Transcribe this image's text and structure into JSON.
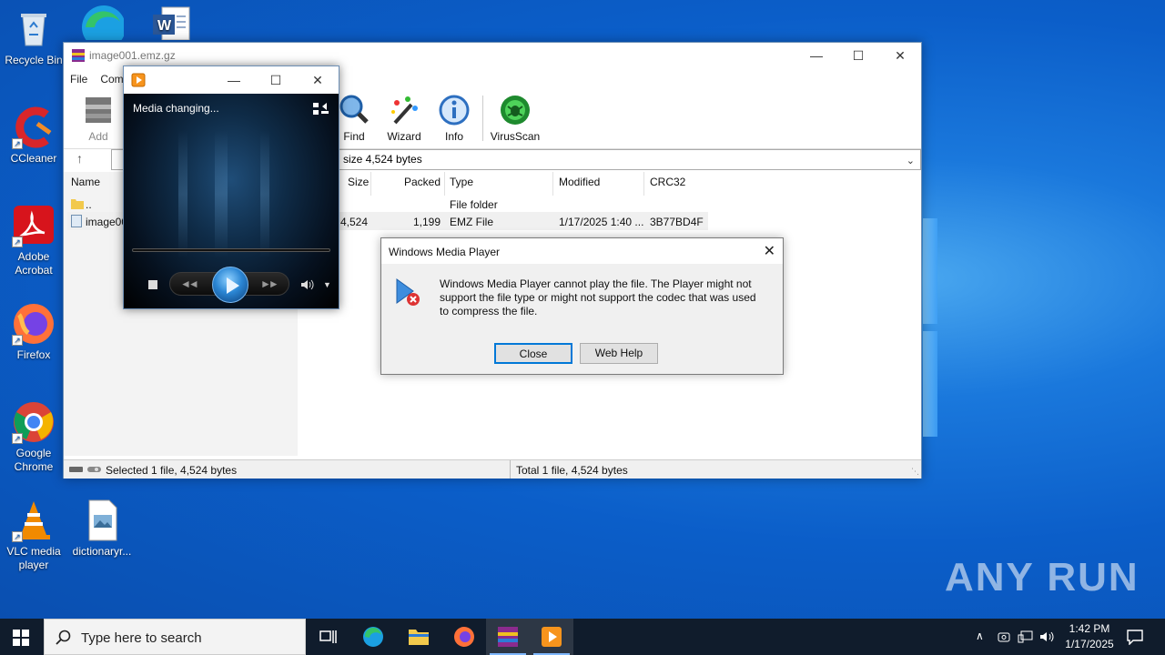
{
  "desktop": {
    "icons": [
      {
        "label": "Recycle Bin"
      },
      {
        "label": "CCleaner"
      },
      {
        "label": "Adobe\nAcrobat"
      },
      {
        "label": "Firefox"
      },
      {
        "label": "Google\nChrome"
      },
      {
        "label": "VLC media\nplayer"
      },
      {
        "label": "dictionaryr..."
      }
    ],
    "watermark": "ANY RUN"
  },
  "winrar": {
    "title": "image001.emz.gz",
    "menu": [
      "File",
      "Comi"
    ],
    "toolbar": {
      "add": "Add",
      "find": "Find",
      "wizard": "Wizard",
      "info": "Info",
      "virusscan": "VirusScan"
    },
    "address_text": "size 4,524 bytes",
    "columns": {
      "name": "Name",
      "size": "Size",
      "packed": "Packed",
      "type": "Type",
      "modified": "Modified",
      "crc": "CRC32"
    },
    "rows": [
      {
        "name": "..",
        "size": "",
        "packed": "",
        "type": "File folder",
        "modified": "",
        "crc": ""
      },
      {
        "name": "image00",
        "size": "4,524",
        "packed": "1,199",
        "type": "EMZ File",
        "modified": "1/17/2025 1:40 ...",
        "crc": "3B77BD4F"
      }
    ],
    "status_left": "Selected 1 file, 4,524 bytes",
    "status_right": "Total 1 file, 4,524 bytes"
  },
  "wmp": {
    "status": "Media changing..."
  },
  "dialog": {
    "title": "Windows Media Player",
    "message": "Windows Media Player cannot play the file. The Player might not support the file type or might not support the codec that was used to compress the file.",
    "close_label": "Close",
    "webhelp_label": "Web Help"
  },
  "taskbar": {
    "search_placeholder": "Type here to search",
    "time": "1:42 PM",
    "date": "1/17/2025"
  }
}
